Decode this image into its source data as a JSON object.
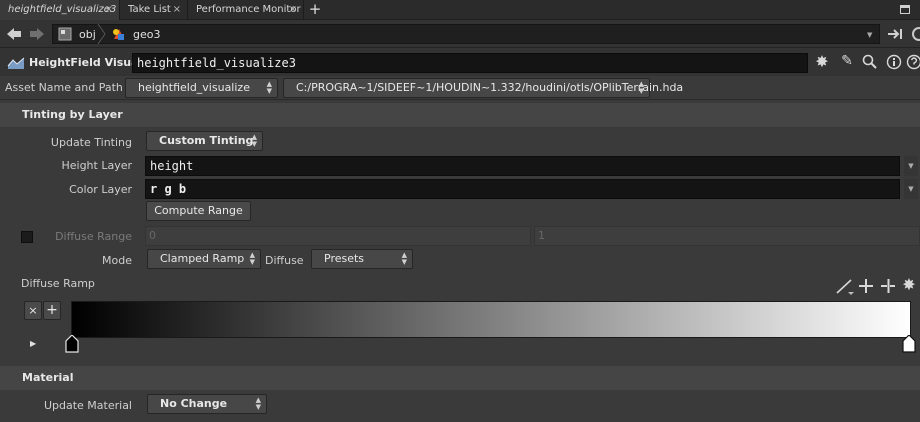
{
  "tabs": [
    {
      "label": "heightfield_visualize3",
      "active": true
    },
    {
      "label": "Take List",
      "active": false
    },
    {
      "label": "Performance Monitor",
      "active": false
    }
  ],
  "tab_close_glyph": "×",
  "tab_add_glyph": "+",
  "path": {
    "obj_label": "obj",
    "geo_label": "geo3"
  },
  "node": {
    "type_label": "HeightField Visualize",
    "name": "heightfield_visualize3"
  },
  "asset": {
    "label": "Asset Name and Path",
    "name": "heightfield_visualize",
    "path": "C:/PROGRA~1/SIDEEF~1/HOUDIN~1.332/houdini/otls/OPlibTerrain.hda"
  },
  "tinting": {
    "section_title": "Tinting by Layer",
    "update_tinting_label": "Update Tinting",
    "update_tinting_value": "Custom Tinting",
    "height_layer_label": "Height Layer",
    "height_layer_value": "height",
    "color_layer_label": "Color Layer",
    "color_layer_value": "r g b",
    "compute_range_label": "Compute Range",
    "diffuse_range_label": "Diffuse Range",
    "diffuse_range_min": "0",
    "diffuse_range_max": "1",
    "mode_label": "Mode",
    "mode_value": "Clamped Ramp",
    "diffuse_label": "Diffuse",
    "presets_value": "Presets",
    "diffuse_ramp_label": "Diffuse Ramp",
    "ramp_remove_glyph": "×",
    "ramp_add_glyph": "+"
  },
  "material": {
    "section_title": "Material",
    "update_material_label": "Update Material",
    "update_material_value": "No Change"
  },
  "colors": {
    "ramp_start": "#000000",
    "ramp_end": "#ffffff",
    "field_bg": "#141414"
  }
}
